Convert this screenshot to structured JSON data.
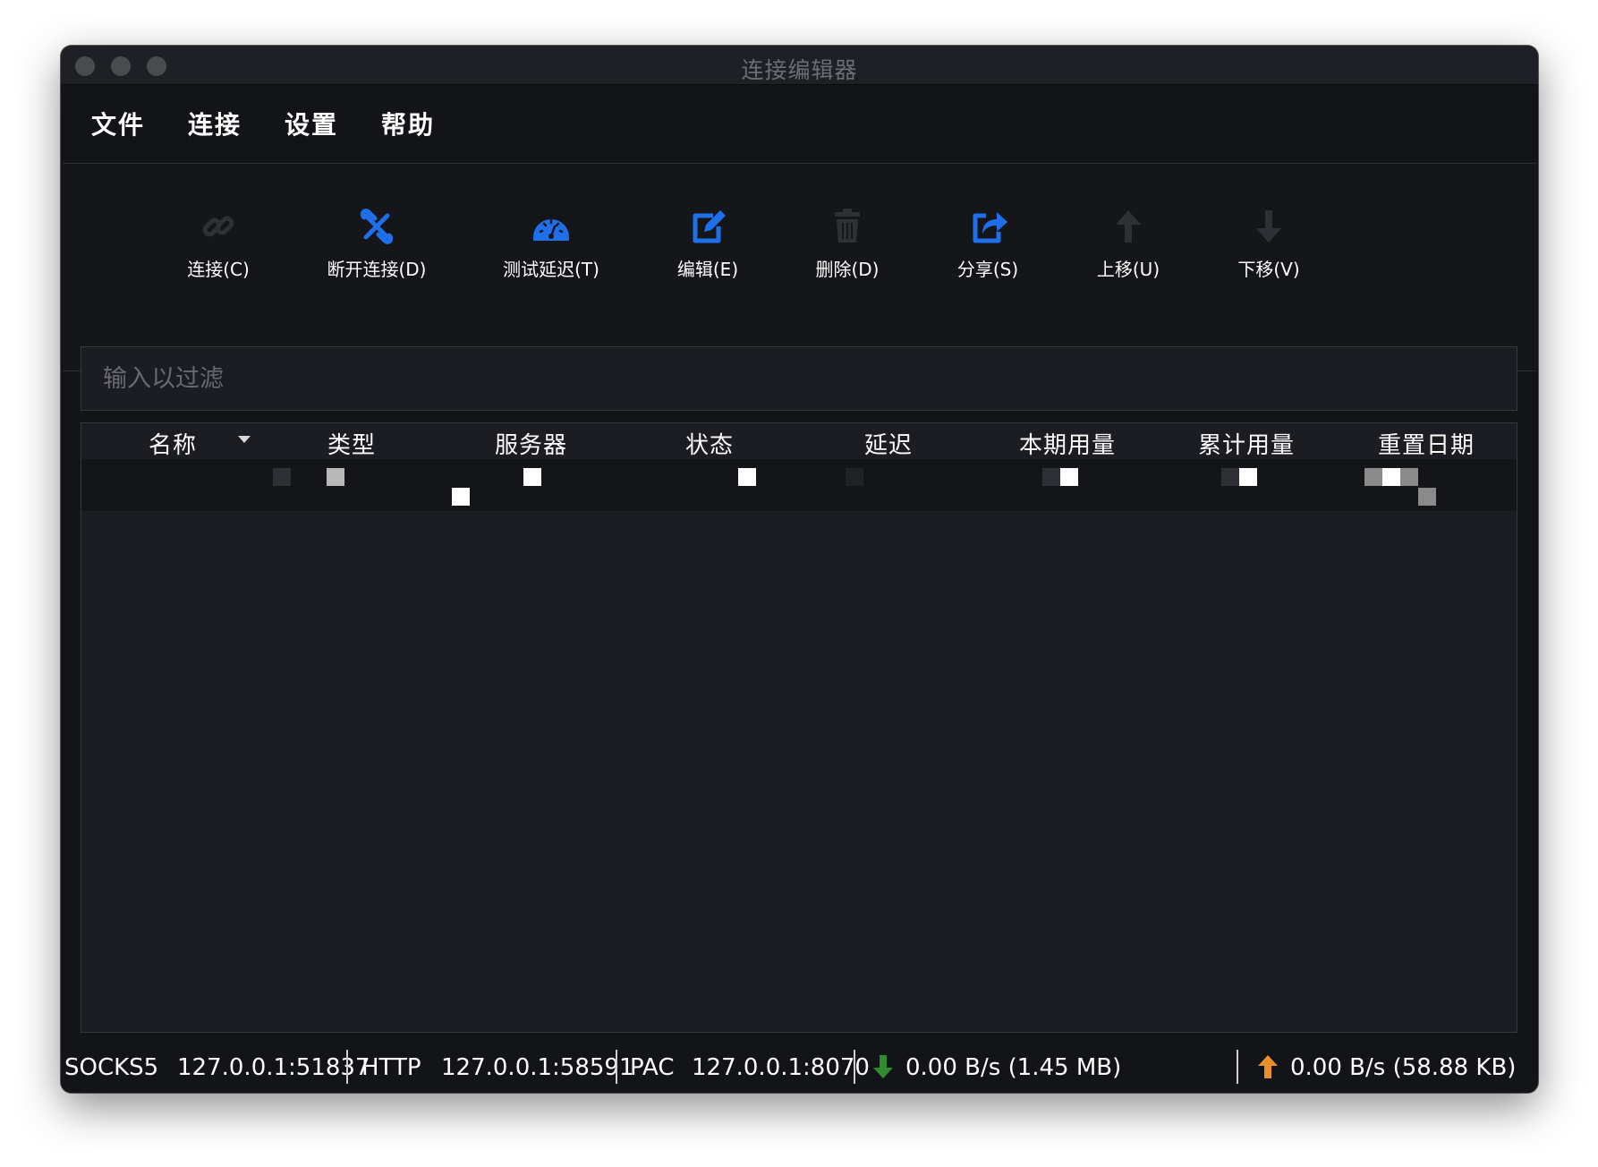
{
  "window": {
    "title": "连接编辑器"
  },
  "menu": [
    "文件",
    "连接",
    "设置",
    "帮助"
  ],
  "toolbar": [
    {
      "label": "连接(C)",
      "icon": "link-icon",
      "enabled": false
    },
    {
      "label": "断开连接(D)",
      "icon": "disconnect-icon",
      "enabled": true
    },
    {
      "label": "测试延迟(T)",
      "icon": "speedometer-icon",
      "enabled": true
    },
    {
      "label": "编辑(E)",
      "icon": "edit-icon",
      "enabled": true
    },
    {
      "label": "删除(D)",
      "icon": "trash-icon",
      "enabled": false
    },
    {
      "label": "分享(S)",
      "icon": "share-icon",
      "enabled": true
    },
    {
      "label": "上移(U)",
      "icon": "arrow-up-icon",
      "enabled": false
    },
    {
      "label": "下移(V)",
      "icon": "arrow-down-icon",
      "enabled": false
    }
  ],
  "filter": {
    "placeholder": "输入以过滤",
    "value": ""
  },
  "table": {
    "columns": [
      "名称",
      "类型",
      "服务器",
      "状态",
      "延迟",
      "本期用量",
      "累计用量",
      "重置日期"
    ],
    "sort_column": "名称"
  },
  "status": {
    "socks_label": "SOCKS5",
    "socks_addr": "127.0.0.1:51837",
    "http_label": "HTTP",
    "http_addr": "127.0.0.1:58591",
    "pac_label": "PAC",
    "pac_addr": "127.0.0.1:8070",
    "download": "0.00 B/s (1.45 MB)",
    "upload": "0.00 B/s (58.88 KB)"
  },
  "colors": {
    "accent": "#1f6feb",
    "disabled_icon": "#2e3036",
    "download_arrow": "#2e8b2e",
    "upload_arrow": "#e8902a"
  }
}
